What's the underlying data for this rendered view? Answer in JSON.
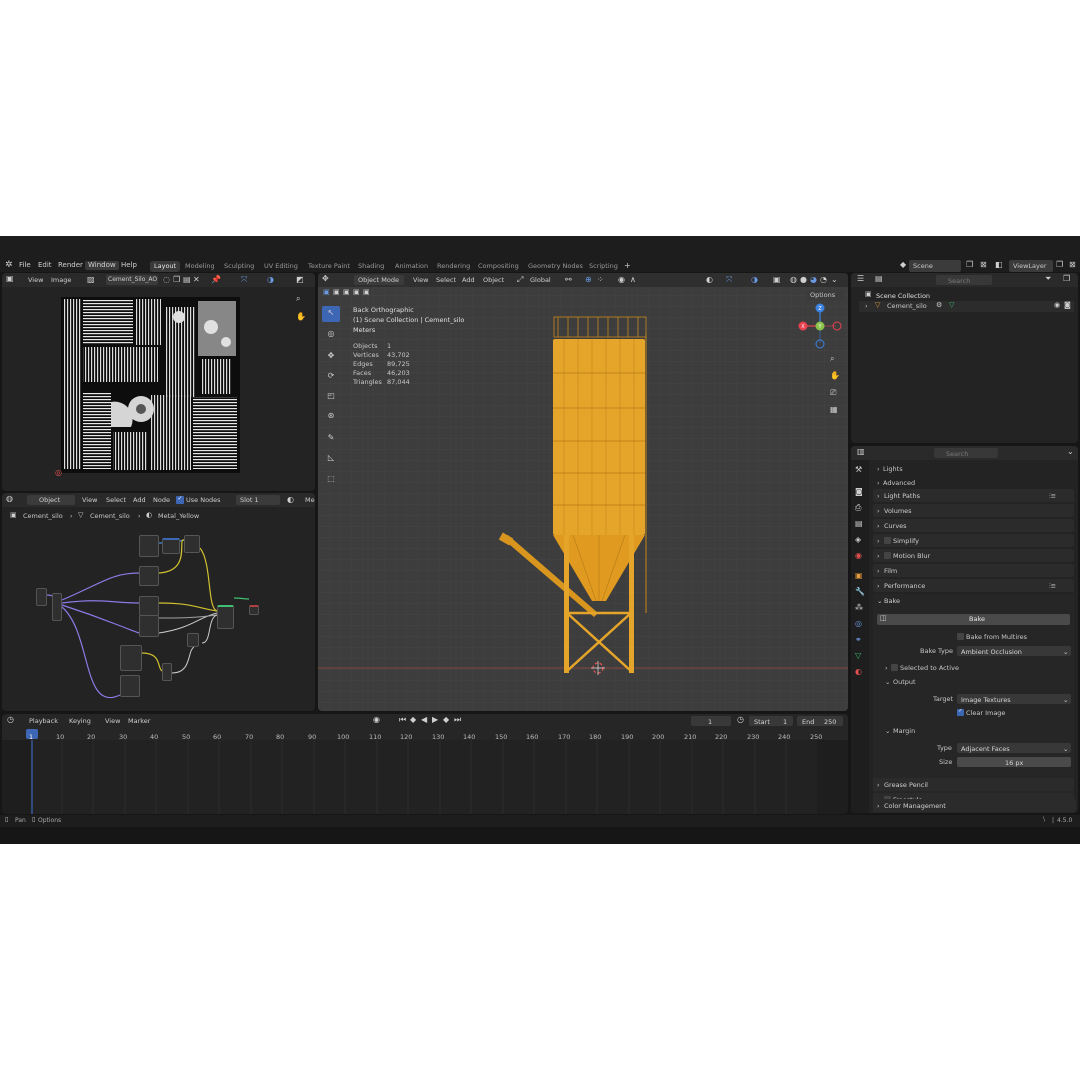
{
  "menu": [
    "File",
    "Edit",
    "Render",
    "Window",
    "Help"
  ],
  "workspaces": [
    "Layout",
    "Modeling",
    "Sculpting",
    "UV Editing",
    "Texture Paint",
    "Shading",
    "Animation",
    "Rendering",
    "Compositing",
    "Geometry Nodes",
    "Scripting"
  ],
  "active_workspace": "Layout",
  "scene": "Scene",
  "view_layer": "ViewLayer",
  "image_editor": {
    "menus": [
      "View",
      "Image"
    ],
    "image_name": "Cement_Silo_AO"
  },
  "node_editor": {
    "object_mode": "Object",
    "menus": [
      "View",
      "Select",
      "Add",
      "Node"
    ],
    "use_nodes_label": "Use Nodes",
    "slot": "Slot 1",
    "material_short": "Me",
    "breadcrumb": [
      "Cement_silo",
      "Cement_silo",
      "Metal_Yellow"
    ]
  },
  "viewport": {
    "mode": "Object Mode",
    "menus": [
      "View",
      "Select",
      "Add",
      "Object"
    ],
    "transform": "Global",
    "options_label": "Options",
    "view_name": "Back Orthographic",
    "collection": "(1) Scene Collection | Cement_silo",
    "units": "Meters",
    "stats": [
      {
        "label": "Objects",
        "value": "1"
      },
      {
        "label": "Vertices",
        "value": "43,702"
      },
      {
        "label": "Edges",
        "value": "89,725"
      },
      {
        "label": "Faces",
        "value": "46,203"
      },
      {
        "label": "Triangles",
        "value": "87,044"
      }
    ],
    "gizmo": {
      "x": "X",
      "y": "Y",
      "z": "Z"
    }
  },
  "outliner": {
    "search_placeholder": "Search",
    "root": "Scene Collection",
    "item": "Cement_silo"
  },
  "properties": {
    "search_placeholder": "Search",
    "lights": "Lights",
    "advanced": "Advanced",
    "light_paths": "Light Paths",
    "volumes": "Volumes",
    "curves": "Curves",
    "simplify": "Simplify",
    "motion_blur": "Motion Blur",
    "film": "Film",
    "performance": "Performance",
    "bake": "Bake",
    "bake_button": "Bake",
    "bake_from_multires": "Bake from Multires",
    "bake_type_label": "Bake Type",
    "bake_type_value": "Ambient Occlusion",
    "selected_to_active": "Selected to Active",
    "output": "Output",
    "target_label": "Target",
    "target_value": "Image Textures",
    "clear_image": "Clear Image",
    "margin": "Margin",
    "type_label": "Type",
    "type_value": "Adjacent Faces",
    "size_label": "Size",
    "size_value": "16 px",
    "grease_pencil": "Grease Pencil",
    "freestyle": "Freestyle",
    "color_management": "Color Management"
  },
  "timeline": {
    "menus": [
      "Playback",
      "Keying",
      "View",
      "Marker"
    ],
    "current_frame": "1",
    "start_label": "Start",
    "start_value": "1",
    "end_label": "End",
    "end_value": "250",
    "ticks": [
      "1",
      "10",
      "20",
      "30",
      "40",
      "50",
      "60",
      "70",
      "80",
      "90",
      "100",
      "110",
      "120",
      "130",
      "140",
      "150",
      "160",
      "170",
      "180",
      "190",
      "200",
      "210",
      "220",
      "230",
      "240",
      "250"
    ]
  },
  "statusbar": {
    "left": [
      "Pan",
      "Options"
    ],
    "version": "4.5.0"
  },
  "colors": {
    "accent": "#3d66b5",
    "silo": "#e5a52a",
    "axis_x": "#e8414f",
    "axis_y": "#8bc34a",
    "axis_z": "#3b82e0"
  }
}
